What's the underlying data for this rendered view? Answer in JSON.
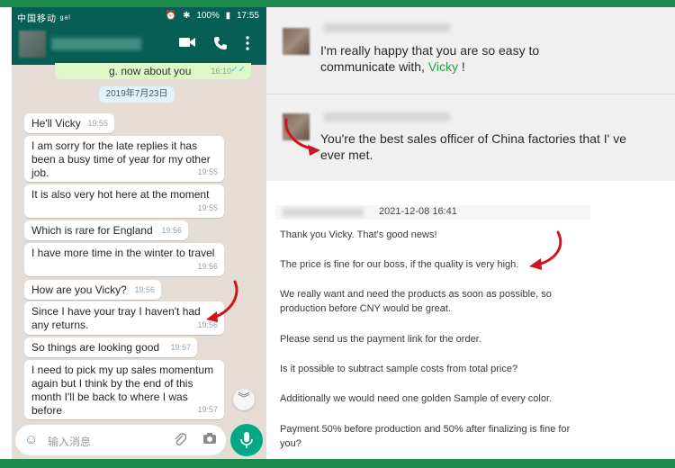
{
  "whatsapp": {
    "status_left": "中国移动 ᵍᵃˡ",
    "status_battery": "100%",
    "status_time": "17:55",
    "partial_message": {
      "text": "g. now about you",
      "time": "16:10",
      "tick": "✓✓"
    },
    "date_chip": "2019年7月23日",
    "messages": [
      {
        "text": "He'll Vicky",
        "time": "19:55"
      },
      {
        "text": "I am sorry for the late replies it has been a busy time of year for my other job.",
        "time": "19:55"
      },
      {
        "text": "It is also very hot here at the moment",
        "time": "19:55"
      },
      {
        "text": "Which is rare for England",
        "time": "19:56"
      },
      {
        "text": "I have more time in the winter to travel",
        "time": "19:56"
      },
      {
        "text": "How are you Vicky?",
        "time": "19:56"
      },
      {
        "text": "Since I have your tray I haven't had any returns.",
        "time": "19:56"
      },
      {
        "text": "So things are looking good",
        "time": "19:57"
      },
      {
        "text": "I need to pick my up sales momentum again but I think by the end of this month I'll be back to where I was before",
        "time": "19:57"
      }
    ],
    "input_placeholder": "输入消息"
  },
  "review1": {
    "text_before": "I'm really happy that you are so easy to communicate with, ",
    "highlight": "Vicky",
    "text_after": " !"
  },
  "review2": {
    "text": "You're the best sales officer of China factories that I' ve ever met."
  },
  "mail": {
    "date": "2021-12-08 16:41",
    "lines": [
      "Thank you Vicky. That's good news!",
      "The price is fine for our boss, if the quality is very high.",
      "We really want and need the products as soon as possible, so",
      "production before CNY would be great.",
      "Please send us the payment link for the order.",
      "Is it possible to subtract sample costs from total price?",
      "Additionally we would need one golden Sample of every color.",
      "Payment 50% before production and 50% after finalizing is fine for",
      "you?"
    ]
  },
  "colors": {
    "frame": "#1e8a4c",
    "wa_header": "#075e54",
    "wa_bg": "#e5ddd5",
    "highlight": "#2e9e3c",
    "arrow": "#d0141d"
  }
}
